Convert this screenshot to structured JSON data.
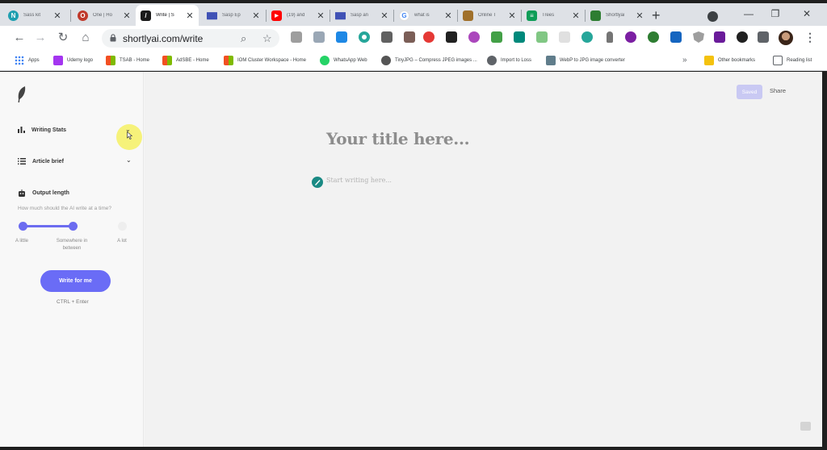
{
  "tabs": [
    {
      "title": "Sass kit",
      "icon_name": "n-logo-icon",
      "color": "#1e9fb0",
      "letter": "N"
    },
    {
      "title": "One | Ho",
      "icon_name": "octopus-icon",
      "color": "#c0392b",
      "letter": "O"
    },
    {
      "title": "Write | S",
      "icon_name": "quill-icon",
      "color": "#1a1a1a",
      "letter": "/",
      "active": true
    },
    {
      "title": "Sasp Ep",
      "icon_name": "envelope-icon",
      "color": "#3f51b5",
      "letter": ""
    },
    {
      "title": "(19) and",
      "icon_name": "youtube-icon",
      "color": "#ff0000",
      "letter": "▶"
    },
    {
      "title": "Sasp an",
      "icon_name": "envelope-icon",
      "color": "#3f51b5",
      "letter": ""
    },
    {
      "title": "what is",
      "icon_name": "google-icon",
      "color": "#4285f4",
      "letter": "G"
    },
    {
      "title": "Online T",
      "icon_name": "box-icon",
      "color": "#a0702a",
      "letter": ""
    },
    {
      "title": "Trees",
      "icon_name": "sheets-icon",
      "color": "#0f9d58",
      "letter": "≡"
    },
    {
      "title": "Shortlyai",
      "icon_name": "robot-icon",
      "color": "#2e7d32",
      "letter": ""
    }
  ],
  "toolbar": {
    "url": "shortlyai.com/write"
  },
  "bookmarks": [
    {
      "label": "Apps",
      "icon_name": "apps-grid-icon",
      "color": "#4285f4"
    },
    {
      "label": "Udemy logo",
      "icon_name": "udemy-icon",
      "color": "#a435f0"
    },
    {
      "label": "TSAB - Home",
      "icon_name": "microsoft-icon",
      "color": "#f25022"
    },
    {
      "label": "AdSBE - Home",
      "icon_name": "microsoft-icon",
      "color": "#f25022"
    },
    {
      "label": "IOM Cluster Workspace - Home",
      "icon_name": "microsoft-icon",
      "color": "#f25022"
    },
    {
      "label": "WhatsApp Web",
      "icon_name": "whatsapp-icon",
      "color": "#25d366"
    },
    {
      "label": "TinyJPG – Compress JPEG images ...",
      "icon_name": "panda-icon",
      "color": "#555555"
    },
    {
      "label": "Import to Loss",
      "icon_name": "globe-icon",
      "color": "#5f6368"
    },
    {
      "label": "WebP to JPG image converter",
      "icon_name": "image-icon",
      "color": "#607d8b"
    },
    {
      "label": "Other bookmarks",
      "icon_name": "folder-icon",
      "color": "#f4c20d"
    },
    {
      "label": "Reading list",
      "icon_name": "reading-list-icon",
      "color": "#5f6368"
    }
  ],
  "sidebar": {
    "writing_stats": "Writing Stats",
    "article_brief": "Article brief",
    "output_length": "Output length",
    "hint": "How much should the AI write at a time?",
    "slider_labels": [
      "A little",
      "Somewhere in between",
      "A lot"
    ],
    "slider_value": "Somewhere in between",
    "write_button": "Write for me",
    "shortcut": "CTRL + Enter"
  },
  "editor": {
    "save_button": "Saved",
    "share_button": "Share",
    "title_placeholder": "Your title here...",
    "body_placeholder": "Start writing here..."
  },
  "colors": {
    "accent": "#6a6cf6",
    "ai_icon": "#1a8a84"
  }
}
